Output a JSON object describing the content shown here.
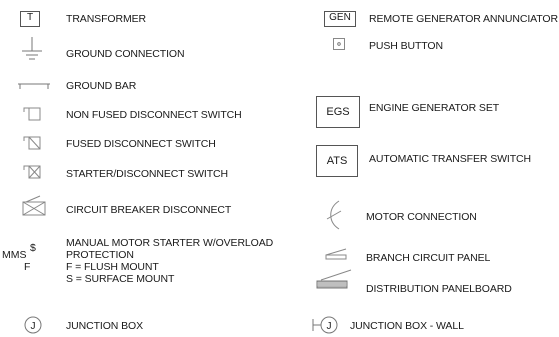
{
  "legend": {
    "left": [
      {
        "symbol": "T",
        "label": "TRANSFORMER"
      },
      {
        "symbol": "ground-icon",
        "label": "GROUND CONNECTION"
      },
      {
        "symbol": "ground-bar-icon",
        "label": "GROUND BAR"
      },
      {
        "symbol": "non-fused-disconnect-icon",
        "label": "NON FUSED DISCONNECT SWITCH"
      },
      {
        "symbol": "fused-disconnect-icon",
        "label": "FUSED DISCONNECT SWITCH"
      },
      {
        "symbol": "starter-disconnect-icon",
        "label": "STARTER/DISCONNECT SWITCH"
      },
      {
        "symbol": "circuit-breaker-disconnect-icon",
        "label": "CIRCUIT BREAKER DISCONNECT"
      },
      {
        "symbol": "MMS $ F",
        "label_lines": [
          "MANUAL MOTOR STARTER W/OVERLOAD",
          "PROTECTION",
          "F = FLUSH MOUNT",
          "S = SURFACE MOUNT"
        ]
      },
      {
        "symbol": "J",
        "label": "JUNCTION BOX"
      }
    ],
    "right": [
      {
        "symbol": "GEN",
        "label": "REMOTE GENERATOR ANNUNCIATOR"
      },
      {
        "symbol": "push-button-icon",
        "label": "PUSH BUTTON"
      },
      {
        "symbol": "EGS",
        "label": "ENGINE GENERATOR SET"
      },
      {
        "symbol": "ATS",
        "label": "AUTOMATIC TRANSFER SWITCH"
      },
      {
        "symbol": "motor-connection-icon",
        "label": "MOTOR CONNECTION"
      },
      {
        "symbol": "branch-circuit-panel-icon",
        "label": "BRANCH CIRCUIT PANEL"
      },
      {
        "symbol": "distribution-panelboard-icon",
        "label": "DISTRIBUTION PANELBOARD"
      },
      {
        "symbol": "J",
        "label": "JUNCTION BOX - WALL"
      }
    ],
    "mms_text": {
      "mms": "MMS",
      "dollar": "$",
      "f": "F"
    }
  }
}
